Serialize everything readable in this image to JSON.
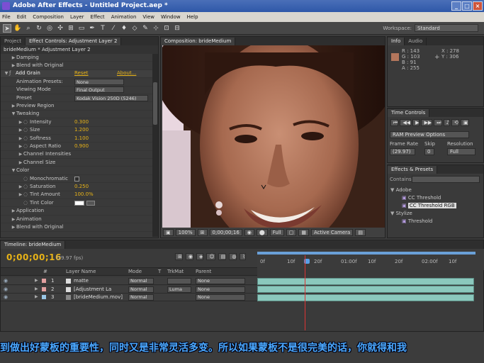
{
  "window": {
    "title": "Adobe After Effects - Untitled Project.aep *",
    "buttons": [
      "_",
      "□",
      "×"
    ]
  },
  "menu": [
    "File",
    "Edit",
    "Composition",
    "Layer",
    "Effect",
    "Animation",
    "View",
    "Window",
    "Help"
  ],
  "toolbar": {
    "workspace_label": "Workspace:",
    "workspace_value": "Standard"
  },
  "left_panel": {
    "tabs": [
      "Project",
      "Effect Controls: Adjustment Layer 2"
    ],
    "header": "brideMedium * Adjustment Layer 2",
    "rows": [
      {
        "indent": 1,
        "twirl": "▶",
        "label": "Damping"
      },
      {
        "indent": 1,
        "twirl": "▶",
        "label": "Blend with Original"
      },
      {
        "indent": 0,
        "twirl": "▼",
        "label": "Add Grain",
        "fx": true,
        "reset": "Reset",
        "about": "About..."
      },
      {
        "indent": 1,
        "label": "Animation Presets:",
        "select": "None"
      },
      {
        "indent": 1,
        "label": "Viewing Mode",
        "select": "Final Output"
      },
      {
        "indent": 1,
        "label": "Preset",
        "select": "Kodak Vision 250D (5246)"
      },
      {
        "indent": 1,
        "twirl": "▶",
        "label": "Preview Region"
      },
      {
        "indent": 1,
        "twirl": "▼",
        "label": "Tweaking"
      },
      {
        "indent": 2,
        "twirl": "▶",
        "label": "Intensity",
        "value": "0.300"
      },
      {
        "indent": 2,
        "twirl": "▶",
        "label": "Size",
        "value": "1.200"
      },
      {
        "indent": 2,
        "twirl": "▶",
        "label": "Softness",
        "value": "1.100"
      },
      {
        "indent": 2,
        "twirl": "▶",
        "label": "Aspect Ratio",
        "value": "0.900"
      },
      {
        "indent": 2,
        "twirl": "▶",
        "label": "Channel Intensities"
      },
      {
        "indent": 2,
        "twirl": "▶",
        "label": "Channel Size"
      },
      {
        "indent": 1,
        "twirl": "▼",
        "label": "Color"
      },
      {
        "indent": 2,
        "label": "Monochromatic",
        "checkbox": true
      },
      {
        "indent": 2,
        "twirl": "▶",
        "label": "Saturation",
        "value": "0.250"
      },
      {
        "indent": 2,
        "twirl": "▶",
        "label": "Tint Amount",
        "value": "100.0%"
      },
      {
        "indent": 2,
        "label": "Tint Color",
        "color": true
      },
      {
        "indent": 1,
        "twirl": "▶",
        "label": "Application"
      },
      {
        "indent": 1,
        "twirl": "▶",
        "label": "Animation"
      },
      {
        "indent": 1,
        "twirl": "▶",
        "label": "Blend with Original"
      }
    ]
  },
  "comp_panel": {
    "tab": "Composition: brideMedium",
    "zoom": "100%",
    "timecode": "0;00;00;16",
    "resolution": "Full",
    "camera": "Active Camera"
  },
  "info_panel": {
    "tabs": [
      "Info",
      "Audio"
    ],
    "r": "R : 143",
    "g": "G : 103",
    "b": "B : 91",
    "a": "A : 255",
    "x": "X : 278",
    "y": "Y : 306",
    "sample_color": "#b3765c"
  },
  "time_controls": {
    "tab": "Time Controls",
    "ram_preview": "RAM Preview Options",
    "frame_rate_label": "Frame Rate",
    "skip_label": "Skip",
    "resolution_label": "Resolution",
    "frame_rate": "(29.97)",
    "skip": "0",
    "resolution": "Full"
  },
  "effects_presets": {
    "tab": "Effects & Presets",
    "search_label": "Contains:",
    "items": [
      {
        "type": "folder",
        "label": "Adobe"
      },
      {
        "type": "effect",
        "label": "CC Threshold"
      },
      {
        "type": "effect",
        "label": "CC Threshold RGB",
        "selected": true
      },
      {
        "type": "folder",
        "label": "Stylize"
      },
      {
        "type": "effect",
        "label": "Threshold"
      }
    ]
  },
  "timeline": {
    "tab": "Timeline: brideMedium",
    "timecode": "0;00;00;16",
    "fps": "(29.97 fps)",
    "columns": [
      "#",
      "Layer Name",
      "Mode",
      "T",
      "TrkMat",
      "Parent"
    ],
    "layers": [
      {
        "num": "1",
        "name": "matte",
        "mode": "Normal",
        "trkmat": "",
        "parent": "None",
        "color": "#e3a0a0"
      },
      {
        "num": "2",
        "name": "[Adjustment La",
        "mode": "Normal",
        "trkmat": "Luma",
        "parent": "None",
        "color": "#e3a0a0"
      },
      {
        "num": "3",
        "name": "[brideMedium.mov]",
        "mode": "Normal",
        "trkmat": "",
        "parent": "None",
        "color": "#9ac7e6"
      }
    ],
    "ruler": [
      "0f",
      "10f",
      "20f",
      "01:00f",
      "10f",
      "20f",
      "02:00f",
      "10f"
    ]
  },
  "subtitle": "到做出好蒙板的重要性，同时又是非常灵活多变。所以如果蒙板不是很完美的话，你就得和我"
}
